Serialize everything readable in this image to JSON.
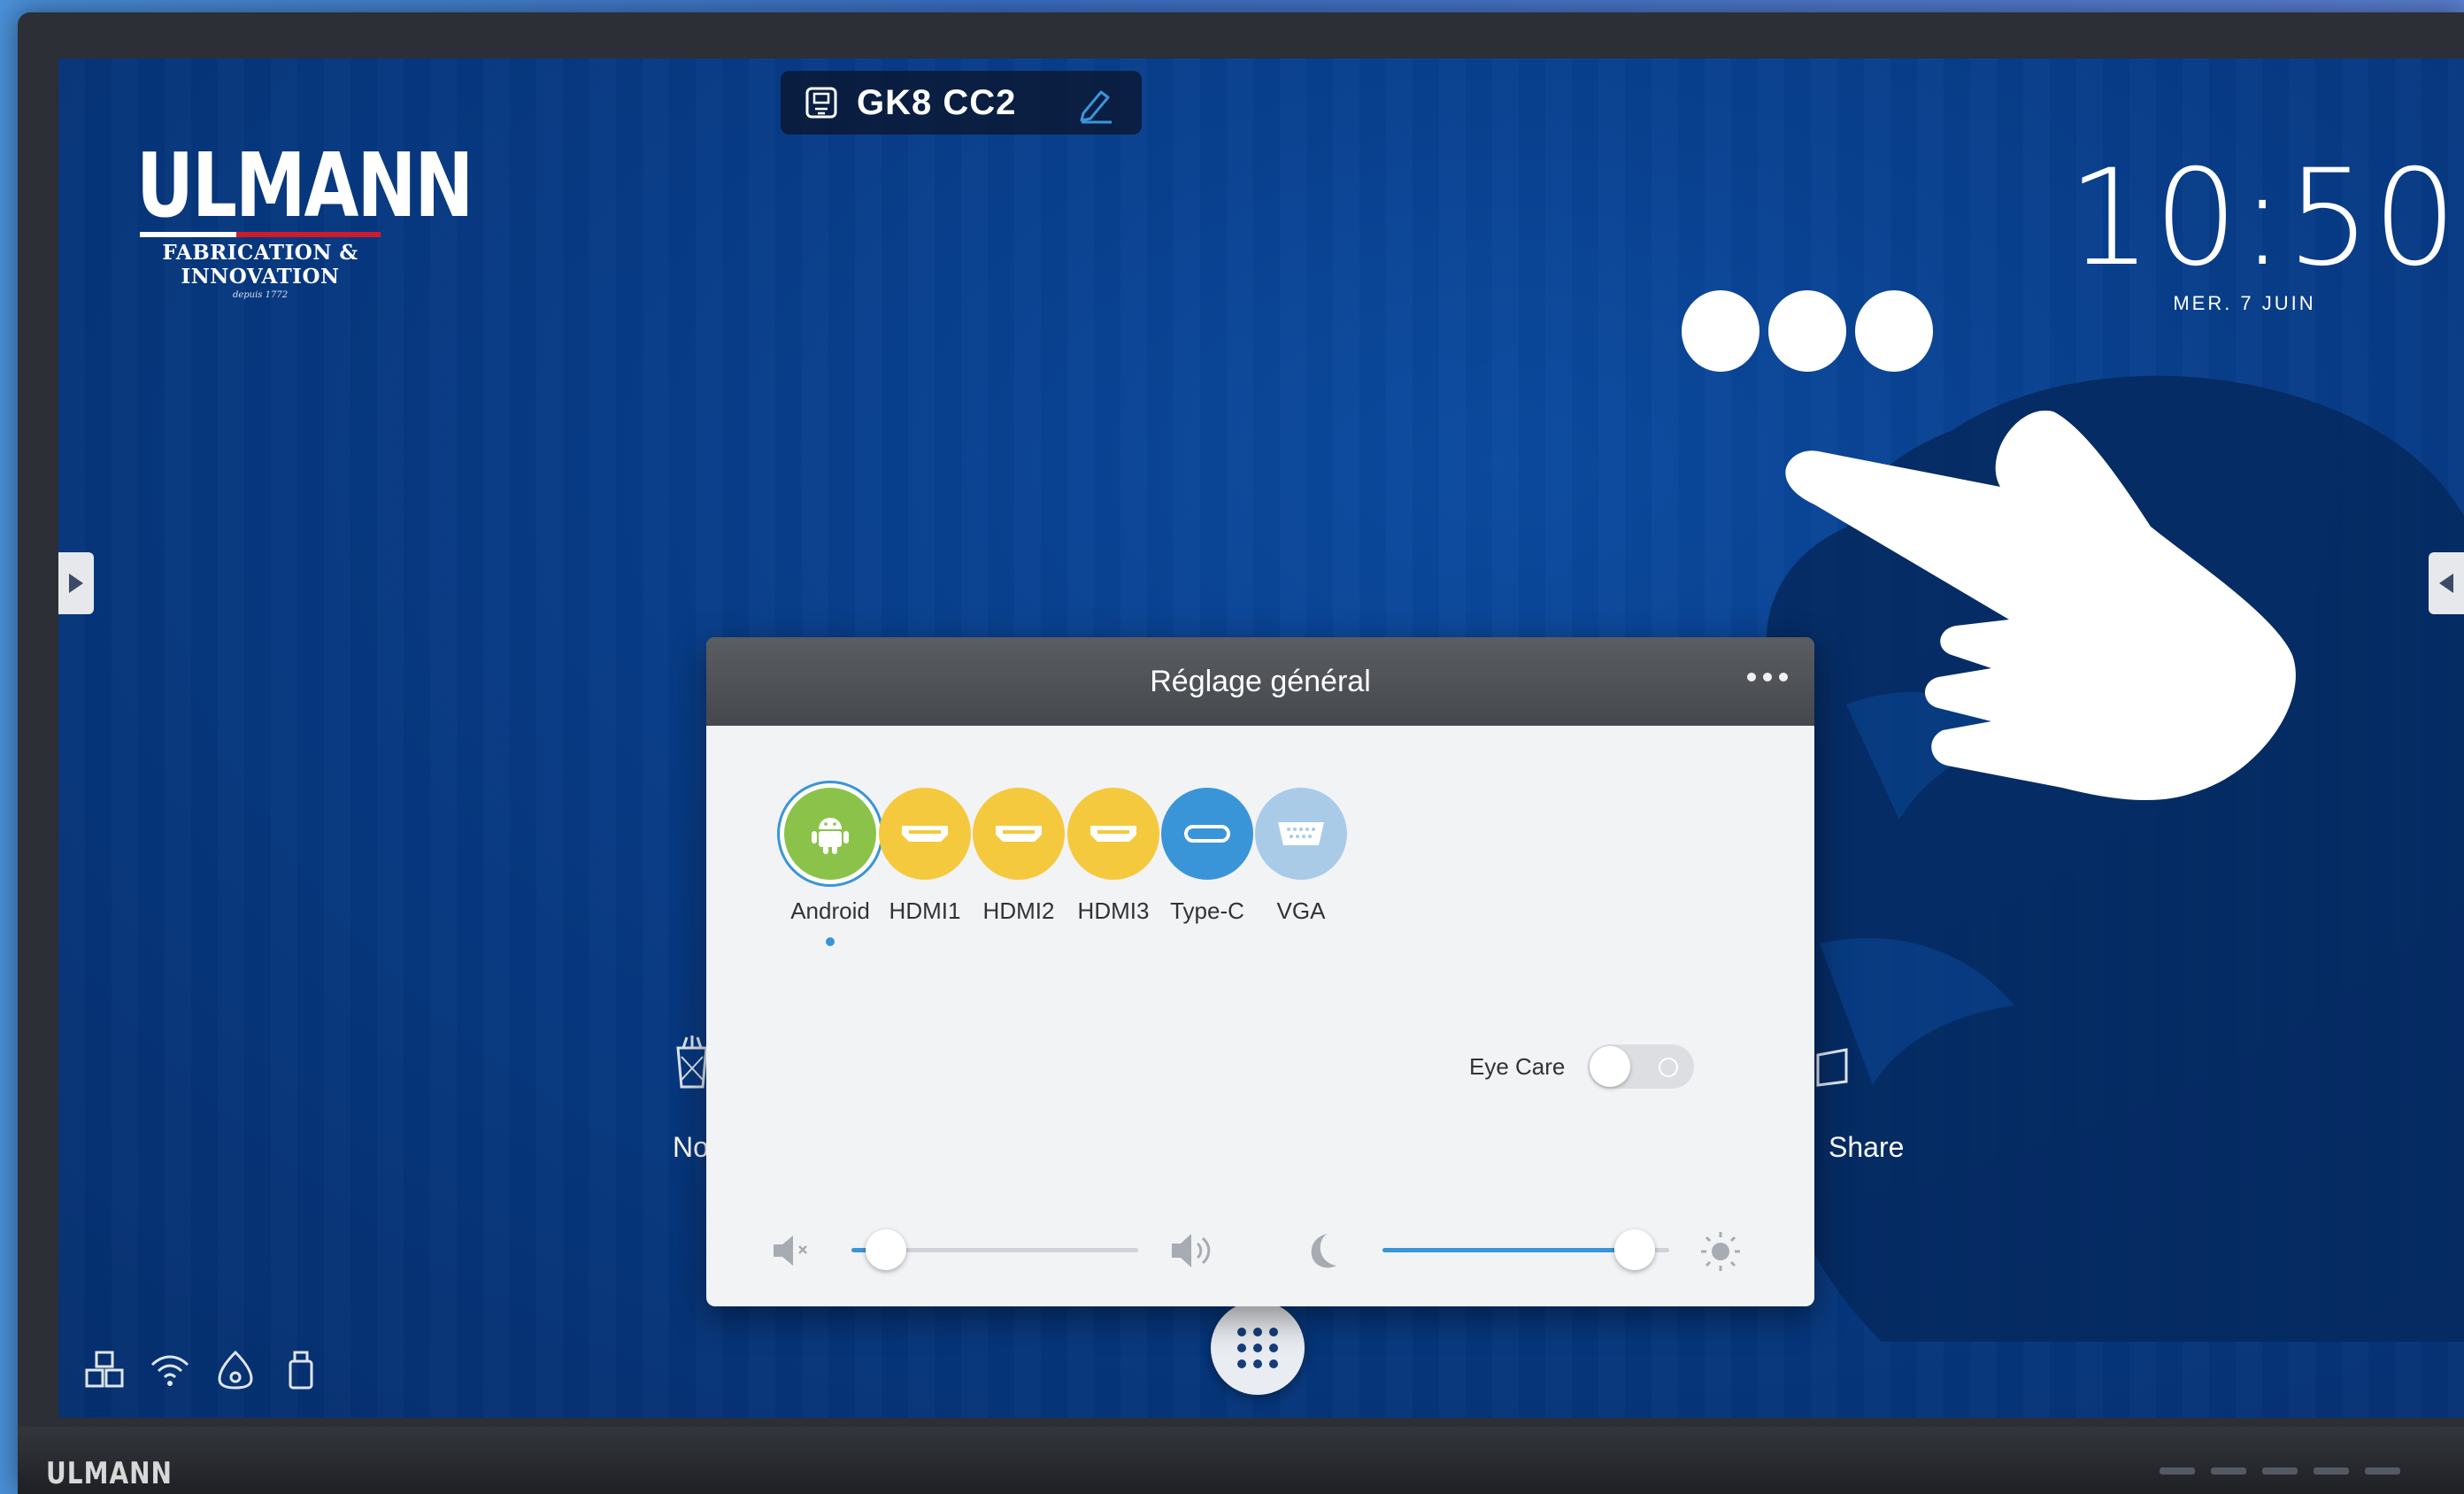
{
  "brand": {
    "name": "ULMANN",
    "subtitle": "FABRICATION & INNOVATION",
    "since": "depuis 1772",
    "bezel_logo": "ULMANN"
  },
  "device": {
    "name": "GK8 CC2"
  },
  "clock": {
    "time": "10:50",
    "date": "MER. 7 JUIN"
  },
  "desktop": {
    "left_label": "No",
    "right_label": "Share"
  },
  "panel": {
    "title": "Réglage général",
    "sources": [
      {
        "label": "Android",
        "color": "#8bc34a",
        "icon": "android-icon",
        "active": true
      },
      {
        "label": "HDMI1",
        "color": "#f5c93e",
        "icon": "hdmi-port-icon"
      },
      {
        "label": "HDMI2",
        "color": "#f5c93e",
        "icon": "hdmi-port-icon"
      },
      {
        "label": "HDMI3",
        "color": "#f5c93e",
        "icon": "hdmi-port-icon"
      },
      {
        "label": "Type-C",
        "color": "#3a95d8",
        "icon": "usb-c-icon"
      },
      {
        "label": "VGA",
        "color": "#a9cbe8",
        "icon": "vga-port-icon"
      }
    ],
    "eye_care": {
      "label": "Eye Care",
      "on": false
    },
    "volume_level": 0.12,
    "brightness_level": 0.88
  },
  "colors": {
    "accent": "#3a95d8",
    "screen_bg": "#073b86",
    "panel_header": "#4f5256"
  }
}
